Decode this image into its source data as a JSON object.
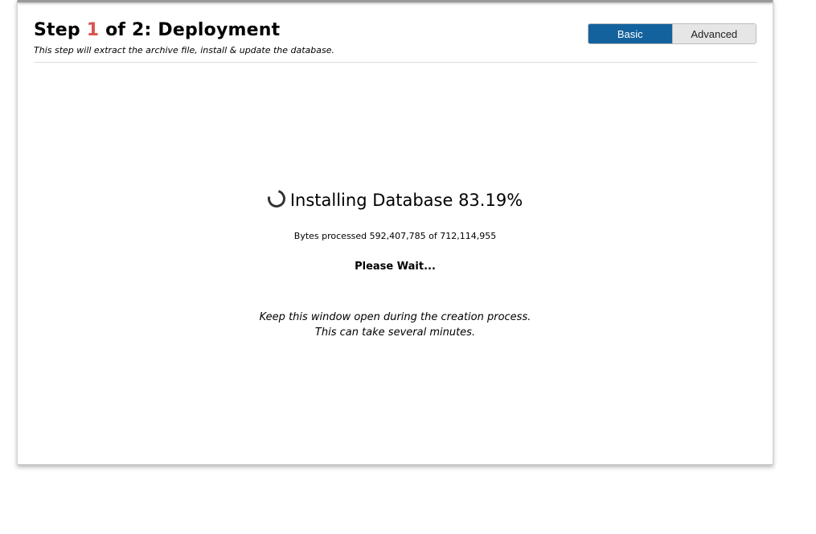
{
  "header": {
    "title_prefix": "Step ",
    "step_current": "1",
    "title_suffix": " of 2: Deployment",
    "subtitle": "This step will extract the archive file, install & update the database."
  },
  "mode_toggle": {
    "basic_label": "Basic",
    "advanced_label": "Advanced",
    "selected": "Basic"
  },
  "progress": {
    "status_text": "Installing Database 83.19%",
    "percent": 83.19,
    "bytes_text": "Bytes processed 592,407,785 of 712,114,955",
    "wait_text": "Please Wait...",
    "note_line1": "Keep this window open during the creation process.",
    "note_line2": "This can take several minutes."
  },
  "colors": {
    "accent_step": "#d9534f",
    "toggle_active": "#13629e"
  },
  "icons": {
    "spinner": "loading-spinner-icon"
  }
}
